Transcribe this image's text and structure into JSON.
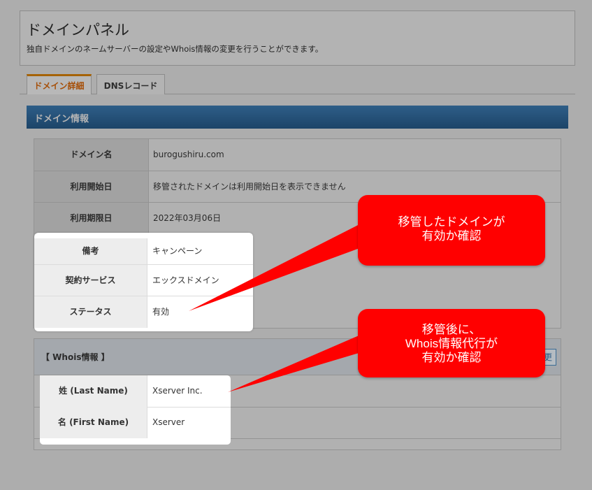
{
  "header": {
    "title": "ドメインパネル",
    "description": "独自ドメインのネームサーバーの設定やWhois情報の変更を行うことができます。"
  },
  "tabs": [
    {
      "label": "ドメイン詳細",
      "active": true
    },
    {
      "label": "DNSレコード",
      "active": false
    }
  ],
  "section": {
    "title": "ドメイン情報"
  },
  "domain_info": {
    "rows": [
      {
        "label": "ドメイン名",
        "value": "burogushiru.com"
      },
      {
        "label": "利用開始日",
        "value": "移管されたドメインは利用開始日を表示できません"
      },
      {
        "label": "利用期限日",
        "value": "2022年03月06日"
      },
      {
        "label": "備考",
        "value": "キャンペーン"
      },
      {
        "label": "契約サービス",
        "value": "エックスドメイン"
      },
      {
        "label": "ステータス",
        "value": "有効"
      }
    ]
  },
  "whois": {
    "title": "【 Whois情報 】",
    "edit_label": "更",
    "rows": [
      {
        "label": "姓 (Last Name)",
        "value": "Xserver Inc."
      },
      {
        "label": "名 (First Name)",
        "value": "Xserver"
      }
    ]
  },
  "callouts": [
    {
      "line1": "移管したドメインが",
      "line2": "有効か確認"
    },
    {
      "line1": "移管後に、",
      "line2": "Whois情報代行が",
      "line3": "有効か確認"
    }
  ],
  "colors": {
    "callout": "#ff0000",
    "section_bar": "#1c4468",
    "active_tab_text": "#a64f08"
  }
}
